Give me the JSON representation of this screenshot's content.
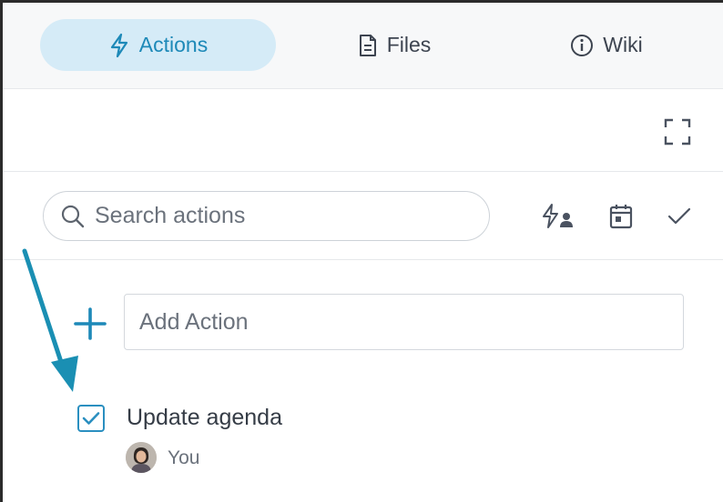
{
  "tabs": [
    {
      "label": "Actions",
      "icon": "lightning-icon",
      "active": true
    },
    {
      "label": "Files",
      "icon": "file-icon",
      "active": false
    },
    {
      "label": "Wiki",
      "icon": "info-icon",
      "active": false
    }
  ],
  "toolbar": {
    "expand_icon": "fullscreen-icon"
  },
  "search": {
    "placeholder": "Search actions"
  },
  "filters": [
    "my-actions-icon",
    "calendar-icon",
    "checkmark-icon"
  ],
  "add_action": {
    "placeholder": "Add Action"
  },
  "actions": [
    {
      "title": "Update agenda",
      "assignee": "You",
      "checked": true
    }
  ],
  "colors": {
    "accent": "#1d89b8",
    "active_tab_bg": "#d5ebf7",
    "annotation_arrow": "#1a8fb3"
  }
}
